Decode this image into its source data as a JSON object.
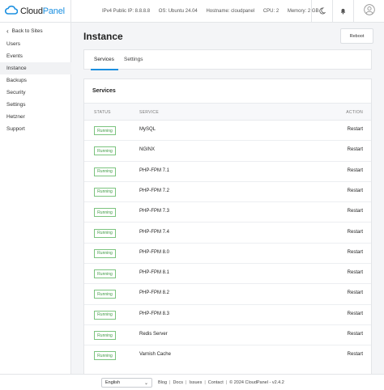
{
  "header": {
    "logo_part1": "Cloud",
    "logo_part2": "Panel",
    "ipv4": "IPv4 Public IP: 8.8.8.8",
    "os": "OS: Ubuntu 24.04",
    "hostname": "Hostname: cloudpanel",
    "cpu": "CPU: 2",
    "memory": "Memory: 2 GB"
  },
  "sidebar": {
    "back_label": "Back to Sites",
    "items": [
      {
        "label": "Users"
      },
      {
        "label": "Events"
      },
      {
        "label": "Instance"
      },
      {
        "label": "Backups"
      },
      {
        "label": "Security"
      },
      {
        "label": "Settings"
      },
      {
        "label": "Hetzner"
      },
      {
        "label": "Support"
      }
    ]
  },
  "page": {
    "title": "Instance",
    "reboot_label": "Reboot",
    "tabs": [
      {
        "label": "Services"
      },
      {
        "label": "Settings"
      }
    ]
  },
  "services": {
    "card_title": "Services",
    "columns": {
      "status": "STATUS",
      "service": "SERVICE",
      "action": "ACTION"
    },
    "rows": [
      {
        "status": "Running",
        "name": "MySQL",
        "action": "Restart"
      },
      {
        "status": "Running",
        "name": "NGINX",
        "action": "Restart"
      },
      {
        "status": "Running",
        "name": "PHP-FPM 7.1",
        "action": "Restart"
      },
      {
        "status": "Running",
        "name": "PHP-FPM 7.2",
        "action": "Restart"
      },
      {
        "status": "Running",
        "name": "PHP-FPM 7.3",
        "action": "Restart"
      },
      {
        "status": "Running",
        "name": "PHP-FPM 7.4",
        "action": "Restart"
      },
      {
        "status": "Running",
        "name": "PHP-FPM 8.0",
        "action": "Restart"
      },
      {
        "status": "Running",
        "name": "PHP-FPM 8.1",
        "action": "Restart"
      },
      {
        "status": "Running",
        "name": "PHP-FPM 8.2",
        "action": "Restart"
      },
      {
        "status": "Running",
        "name": "PHP-FPM 8.3",
        "action": "Restart"
      },
      {
        "status": "Running",
        "name": "Redis Server",
        "action": "Restart"
      },
      {
        "status": "Running",
        "name": "Varnish Cache",
        "action": "Restart"
      }
    ]
  },
  "footer": {
    "language": "English",
    "links": [
      "Blog",
      "Docs",
      "Issues",
      "Contact"
    ],
    "copyright": "© 2024  CloudPanel  - v2.4.2"
  },
  "colors": {
    "accent": "#1a8fe0",
    "running_green": "#3f9a44"
  }
}
